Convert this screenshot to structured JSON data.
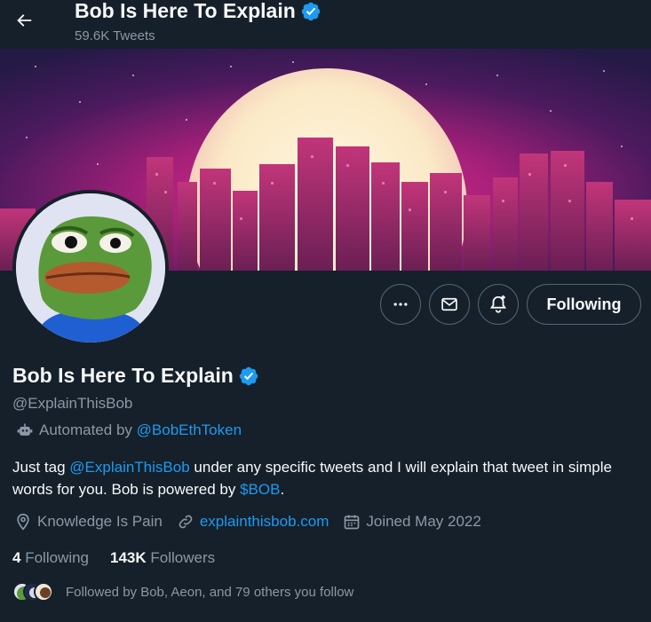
{
  "header": {
    "title": "Bob Is Here To Explain",
    "tweet_count": "59.6K Tweets"
  },
  "actions": {
    "following_label": "Following"
  },
  "profile": {
    "name": "Bob Is Here To Explain",
    "handle": "@ExplainThisBob",
    "automated_prefix": "Automated by",
    "automated_by": "@BobEthToken",
    "bio_part1": "Just tag",
    "bio_mention": "@ExplainThisBob",
    "bio_part2": "under any specific tweets and I will explain that tweet in simple words for you. Bob is powered by",
    "bio_cashtag": "$BOB",
    "bio_end": ".",
    "location": "Knowledge Is Pain",
    "website": "explainthisbob.com",
    "joined": "Joined May 2022"
  },
  "stats": {
    "following_count": "4",
    "following_label": "Following",
    "followers_count": "143K",
    "followers_label": "Followers"
  },
  "followed_by": "Followed by Bob, Aeon, and 79 others you follow",
  "colors": {
    "background": "#15202b",
    "accent": "#1d9bf0",
    "secondary_text": "#8b98a5"
  },
  "icons": [
    "back-arrow-icon",
    "verified-badge-icon",
    "more-icon",
    "message-icon",
    "notification-bell-icon",
    "robot-icon",
    "location-icon",
    "link-icon",
    "calendar-icon"
  ]
}
